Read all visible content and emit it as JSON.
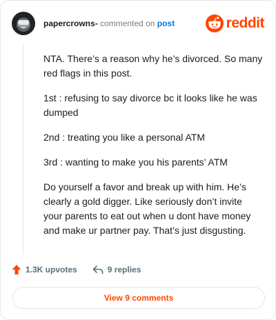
{
  "comment": {
    "author": "papercrowns-",
    "action_text": "commented on",
    "post_link": "post",
    "paragraphs": [
      "NTA. There’s a reason why he’s divorced. So many red flags in this post.",
      "1st : refusing to say divorce bc it looks like he was dumped",
      "2nd : treating you like a personal ATM",
      "3rd : wanting to make you his parents’ ATM",
      "Do yourself a favor and break up with him. He’s clearly a gold digger. Like seriously don’t invite your parents to eat out when u dont have money and make ur partner pay. That’s just disgusting."
    ]
  },
  "brand": {
    "name": "reddit",
    "icon": "reddit-logo-icon",
    "color": "#ff4500"
  },
  "actions": {
    "upvotes": "1.3K upvotes",
    "upvote_icon": "upvote-arrow-icon",
    "replies": "9 replies",
    "reply_icon": "reply-arrow-icon"
  },
  "footer": {
    "view_comments": "View 9 comments"
  },
  "colors": {
    "accent": "#ff4500",
    "link": "#0079d3",
    "muted": "#576f76"
  }
}
